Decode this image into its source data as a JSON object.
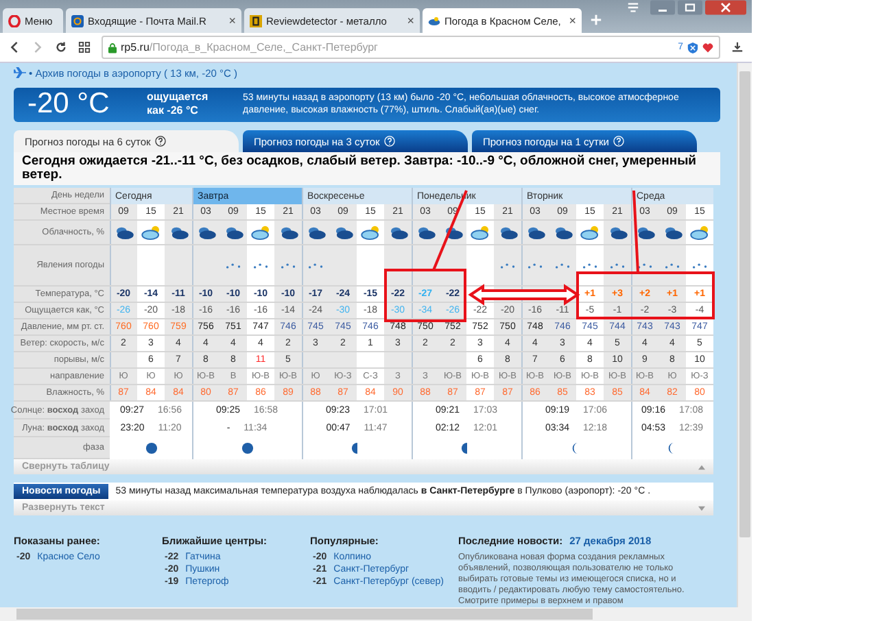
{
  "browser": {
    "tabs": [
      {
        "label": "Меню",
        "kind": "menu",
        "selected": false
      },
      {
        "label": "Входящие - Почта Mail.R",
        "kind": "mail",
        "selected": false,
        "close": "×"
      },
      {
        "label": "Reviewdetector - металло",
        "kind": "review",
        "selected": false,
        "close": "×"
      },
      {
        "label": "Погода в Красном Селе,",
        "kind": "weather",
        "selected": true,
        "close": "×"
      }
    ],
    "address": {
      "domain": "rp5.ru",
      "path": "/Погода_в_Красном_Селе,_Санкт-Петербург"
    },
    "badge_count": "7"
  },
  "archive_link": "• Архив погоды в аэропорту ( 13 км, -20 °C )",
  "current": {
    "temperature": "-20 °C",
    "feels_like": "ощущается как -26 °C",
    "description": "53 минуты назад в аэропорту (13 км) было -20 °C, небольшая облачность, высокое атмосферное давление, высокая влажность (77%), штиль. Слабый(ая)(ые) снег."
  },
  "forecast_tabs": [
    {
      "label": "Прогноз погоды на 6 суток",
      "selected": true
    },
    {
      "label": "Прогноз погоды на 3 суток",
      "selected": false
    },
    {
      "label": "Прогноз погоды на 1 сутки",
      "selected": false
    }
  ],
  "summary": "Сегодня ожидается -21..-11 °C, без осадков, слабый ветер. Завтра: -10..-9 °C, обложной снег, умеренный ветер.",
  "table": {
    "row_labels": {
      "day": "День недели",
      "time": "Местное время",
      "cloud": "Облачность, %",
      "phenomena": "Явления погоды",
      "temp": "Температура, °C",
      "feels": "Ощущается как, °C",
      "pressure": "Давление, мм рт. ст.",
      "wind": "Ветер: скорость, м/с",
      "gust": "порывы, м/с",
      "direction": "направление",
      "humidity": "Влажность, %",
      "sun": "Солнце: **восход** заход",
      "moon": "Луна: **восход** заход",
      "phase": "фаза"
    },
    "days": [
      {
        "name": "Сегодня",
        "highlighted": false,
        "sunrise": "09:27",
        "sunset": "16:56",
        "moonrise": "23:20",
        "moonset": "11:20",
        "moon_phase": {
          "kind": "full"
        },
        "slots": [
          {
            "time": "09",
            "daytime": false,
            "snow": false,
            "temp": "-20",
            "temp_cold": false,
            "temp_warm": false,
            "feels": "-26",
            "feels_cold": true,
            "pressure": "760",
            "pressure_high": true,
            "wind": "2",
            "direction": "Ю",
            "humidity": "87"
          },
          {
            "time": "15",
            "daytime": true,
            "snow": false,
            "temp": "-14",
            "temp_cold": false,
            "temp_warm": false,
            "feels": "-20",
            "feels_cold": false,
            "pressure": "760",
            "pressure_high": true,
            "wind": "3",
            "gust": "6",
            "gust_strong": false,
            "direction": "Ю",
            "humidity": "84"
          },
          {
            "time": "21",
            "daytime": false,
            "snow": false,
            "temp": "-11",
            "temp_cold": false,
            "temp_warm": false,
            "feels": "-18",
            "feels_cold": false,
            "pressure": "759",
            "pressure_high": true,
            "wind": "4",
            "gust": "7",
            "gust_strong": false,
            "direction": "Ю",
            "humidity": "84"
          }
        ]
      },
      {
        "name": "Завтра",
        "highlighted": true,
        "sunrise": "09:25",
        "sunset": "16:58",
        "moonrise": "-",
        "moonset": "11:34",
        "moon_phase": {
          "kind": "full"
        },
        "slots": [
          {
            "time": "03",
            "daytime": false,
            "snow": false,
            "temp": "-10",
            "temp_cold": false,
            "temp_warm": false,
            "feels": "-16",
            "feels_cold": false,
            "pressure": "756",
            "pressure_high": false,
            "pressure_low": false,
            "wind": "4",
            "gust": "8",
            "gust_strong": false,
            "direction": "Ю-В",
            "humidity": "80"
          },
          {
            "time": "09",
            "daytime": false,
            "snow": true,
            "temp": "-10",
            "temp_cold": false,
            "temp_warm": false,
            "feels": "-16",
            "feels_cold": false,
            "pressure": "751",
            "pressure_high": false,
            "pressure_low": false,
            "wind": "4",
            "gust": "8",
            "gust_strong": false,
            "direction": "В",
            "humidity": "87"
          },
          {
            "time": "15",
            "daytime": true,
            "snow": true,
            "temp": "-10",
            "temp_cold": false,
            "temp_warm": false,
            "feels": "-16",
            "feels_cold": false,
            "pressure": "747",
            "pressure_high": false,
            "pressure_low": false,
            "wind": "4",
            "gust": "11",
            "gust_strong": true,
            "direction": "Ю-В",
            "humidity": "86"
          },
          {
            "time": "21",
            "daytime": false,
            "snow": true,
            "temp": "-10",
            "temp_cold": false,
            "temp_warm": false,
            "feels": "-14",
            "feels_cold": false,
            "pressure": "746",
            "pressure_low": true,
            "wind": "2",
            "gust": "5",
            "gust_strong": false,
            "direction": "Ю-В",
            "humidity": "89"
          }
        ]
      },
      {
        "name": "Воскресенье",
        "highlighted": false,
        "sunrise": "09:23",
        "sunset": "17:01",
        "moonrise": "00:47",
        "moonset": "11:47",
        "moon_phase": {
          "kind": "half"
        },
        "slots": [
          {
            "time": "03",
            "daytime": false,
            "snow": true,
            "temp": "-17",
            "temp_cold": false,
            "temp_warm": false,
            "feels": "-24",
            "feels_cold": false,
            "pressure": "745",
            "pressure_low": true,
            "wind": "3",
            "direction": "Ю",
            "humidity": "88"
          },
          {
            "time": "09",
            "daytime": false,
            "snow": false,
            "temp": "-24",
            "temp_cold": false,
            "temp_warm": false,
            "feels": "-30",
            "feels_cold": true,
            "pressure": "745",
            "pressure_low": true,
            "wind": "2",
            "direction": "Ю-З",
            "humidity": "87"
          },
          {
            "time": "15",
            "daytime": true,
            "snow": false,
            "temp": "-15",
            "temp_cold": false,
            "temp_warm": false,
            "feels": "-18",
            "feels_cold": false,
            "pressure": "746",
            "pressure_low": true,
            "wind": "1",
            "direction": "С-З",
            "humidity": "84"
          },
          {
            "time": "21",
            "daytime": false,
            "snow": false,
            "temp": "-22",
            "temp_cold": false,
            "temp_warm": false,
            "feels": "-30",
            "feels_cold": true,
            "pressure": "748",
            "pressure_high": false,
            "pressure_low": false,
            "wind": "3",
            "direction": "З",
            "humidity": "90"
          }
        ]
      },
      {
        "name": "Понедельник",
        "highlighted": false,
        "sunrise": "09:21",
        "sunset": "17:03",
        "moonrise": "02:12",
        "moonset": "12:01",
        "moon_phase": {
          "kind": "half"
        },
        "slots": [
          {
            "time": "03",
            "daytime": false,
            "snow": false,
            "temp": "-27",
            "temp_cold": true,
            "feels": "-34",
            "feels_cold": true,
            "pressure": "750",
            "pressure_high": false,
            "pressure_low": false,
            "wind": "2",
            "direction": "З",
            "humidity": "88"
          },
          {
            "time": "09",
            "daytime": false,
            "snow": false,
            "temp": "-22",
            "temp_cold": false,
            "temp_warm": false,
            "feels": "-26",
            "feels_cold": true,
            "pressure": "752",
            "pressure_high": false,
            "pressure_low": false,
            "wind": "2",
            "direction": "Ю-В",
            "humidity": "87"
          },
          {
            "time": "15",
            "daytime": true,
            "snow": false,
            "feels": "-22",
            "feels_cold": false,
            "pressure": "752",
            "pressure_high": false,
            "pressure_low": false,
            "wind": "3",
            "gust": "6",
            "gust_strong": false,
            "direction": "Ю-В",
            "humidity": "87"
          },
          {
            "time": "21",
            "daytime": false,
            "snow": true,
            "feels": "-20",
            "feels_cold": false,
            "pressure": "750",
            "pressure_high": false,
            "pressure_low": false,
            "wind": "4",
            "gust": "8",
            "gust_strong": false,
            "direction": "Ю-В",
            "humidity": "87"
          }
        ]
      },
      {
        "name": "Вторник",
        "highlighted": false,
        "sunrise": "09:19",
        "sunset": "17:06",
        "moonrise": "03:34",
        "moonset": "12:18",
        "moon_phase": {
          "kind": "crescent"
        },
        "slots": [
          {
            "time": "03",
            "daytime": false,
            "snow": true,
            "feels": "-16",
            "feels_cold": false,
            "pressure": "748",
            "pressure_high": false,
            "pressure_low": false,
            "wind": "4",
            "gust": "7",
            "gust_strong": false,
            "direction": "Ю-В",
            "humidity": "86"
          },
          {
            "time": "09",
            "daytime": false,
            "snow": true,
            "feels": "-11",
            "feels_cold": false,
            "pressure": "746",
            "pressure_low": true,
            "wind": "3",
            "gust": "6",
            "gust_strong": false,
            "direction": "Ю-В",
            "humidity": "85"
          },
          {
            "time": "15",
            "daytime": true,
            "snow": true,
            "temp": "+1",
            "temp_warm": true,
            "feels": "-5",
            "feels_cold": false,
            "pressure": "745",
            "pressure_low": true,
            "wind": "4",
            "gust": "8",
            "gust_strong": false,
            "direction": "Ю-В",
            "humidity": "83"
          },
          {
            "time": "21",
            "daytime": false,
            "snow": true,
            "temp": "+3",
            "temp_warm": true,
            "feels": "-1",
            "feels_cold": false,
            "pressure": "744",
            "pressure_low": true,
            "wind": "5",
            "gust": "10",
            "gust_strong": false,
            "direction": "Ю-В",
            "humidity": "85"
          }
        ]
      },
      {
        "name": "Среда",
        "highlighted": false,
        "sunrise": "09:16",
        "sunset": "17:08",
        "moonrise": "04:53",
        "moonset": "12:39",
        "moon_phase": {
          "kind": "crescent"
        },
        "slots": [
          {
            "time": "03",
            "daytime": false,
            "snow": true,
            "temp": "+2",
            "temp_warm": true,
            "feels": "-2",
            "feels_cold": false,
            "pressure": "743",
            "pressure_low": true,
            "wind": "4",
            "gust": "9",
            "gust_strong": false,
            "direction": "Ю-В",
            "humidity": "84"
          },
          {
            "time": "09",
            "daytime": false,
            "snow": true,
            "temp": "+1",
            "temp_warm": true,
            "feels": "-3",
            "feels_cold": false,
            "pressure": "743",
            "pressure_low": true,
            "wind": "4",
            "gust": "8",
            "gust_strong": false,
            "direction": "Ю",
            "humidity": "82"
          },
          {
            "time": "15",
            "daytime": true,
            "snow": true,
            "temp": "+1",
            "temp_warm": true,
            "feels": "-4",
            "feels_cold": false,
            "pressure": "747",
            "pressure_low": true,
            "wind": "5",
            "gust": "10",
            "gust_strong": false,
            "direction": "Ю-З",
            "humidity": "80"
          }
        ]
      }
    ]
  },
  "collapse_table": "Свернуть таблицу",
  "news": {
    "badge": "Новости погоды",
    "text": "53 минуты назад максимальная температура воздуха наблюдалась **в Санкт-Петербурге** в Пулково (аэропорт): -20 °C .",
    "expand": "Развернуть текст"
  },
  "footer": [
    {
      "title": "Показаны ранее:",
      "places": [
        {
          "temp": "-20",
          "name": "Красное Село"
        }
      ]
    },
    {
      "title": "Ближайшие центры:",
      "places": [
        {
          "temp": "-22",
          "name": "Гатчина"
        },
        {
          "temp": "-20",
          "name": "Пушкин"
        },
        {
          "temp": "-19",
          "name": "Петергоф"
        }
      ]
    },
    {
      "title": "Популярные:",
      "places": [
        {
          "temp": "-20",
          "name": "Колпино"
        },
        {
          "temp": "-21",
          "name": "Санкт-Петербург"
        },
        {
          "temp": "-21",
          "name": "Санкт-Петербург (север)"
        }
      ]
    }
  ],
  "latest_news": {
    "title": "Последние новости:",
    "date": "27 декабря 2018",
    "text": "Опубликована новая форма создания рекламных объявлений, позволяющая пользователю не только выбирать готовые темы из имеющегося списка, но и вводить / редактировать любую тему самостоятельно. Смотрите примеры в верхнем и правом"
  }
}
